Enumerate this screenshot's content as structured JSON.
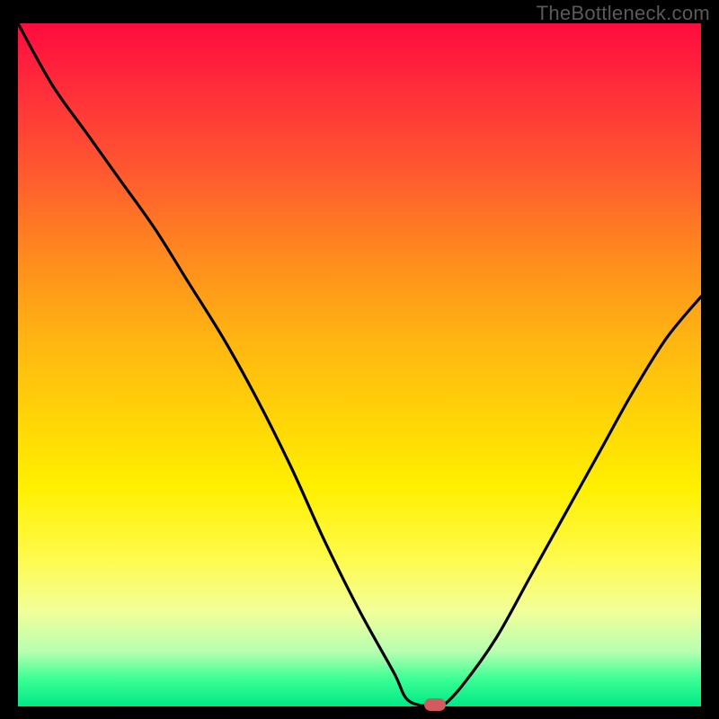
{
  "watermark": "TheBottleneck.com",
  "colors": {
    "frame_bg": "#000000",
    "watermark": "#5a5a5a",
    "curve": "#000000",
    "marker": "#d25a61"
  },
  "chart_data": {
    "type": "line",
    "title": "",
    "xlabel": "",
    "ylabel": "",
    "xlim": [
      0,
      100
    ],
    "ylim": [
      0,
      100
    ],
    "grid": false,
    "legend": false,
    "series": [
      {
        "name": "bottleneck-curve",
        "x": [
          0,
          5,
          10,
          15,
          20,
          25,
          30,
          35,
          40,
          45,
          50,
          55,
          57,
          60,
          62,
          65,
          70,
          75,
          80,
          85,
          90,
          95,
          100
        ],
        "values": [
          100,
          91,
          84,
          77,
          70,
          62,
          54,
          45,
          35,
          24,
          14,
          5,
          1,
          0,
          0,
          3,
          10,
          19,
          28,
          37,
          46,
          54,
          60
        ]
      }
    ],
    "annotations": [
      {
        "name": "optimal-marker",
        "x": 61,
        "y": 0,
        "shape": "pill",
        "color": "#d25a61"
      }
    ],
    "background_gradient": {
      "direction": "vertical",
      "stops": [
        {
          "pos": 0,
          "color": "#ff0b3e"
        },
        {
          "pos": 0.5,
          "color": "#ffd507"
        },
        {
          "pos": 0.78,
          "color": "#fffa4a"
        },
        {
          "pos": 1.0,
          "color": "#00e886"
        }
      ]
    }
  }
}
